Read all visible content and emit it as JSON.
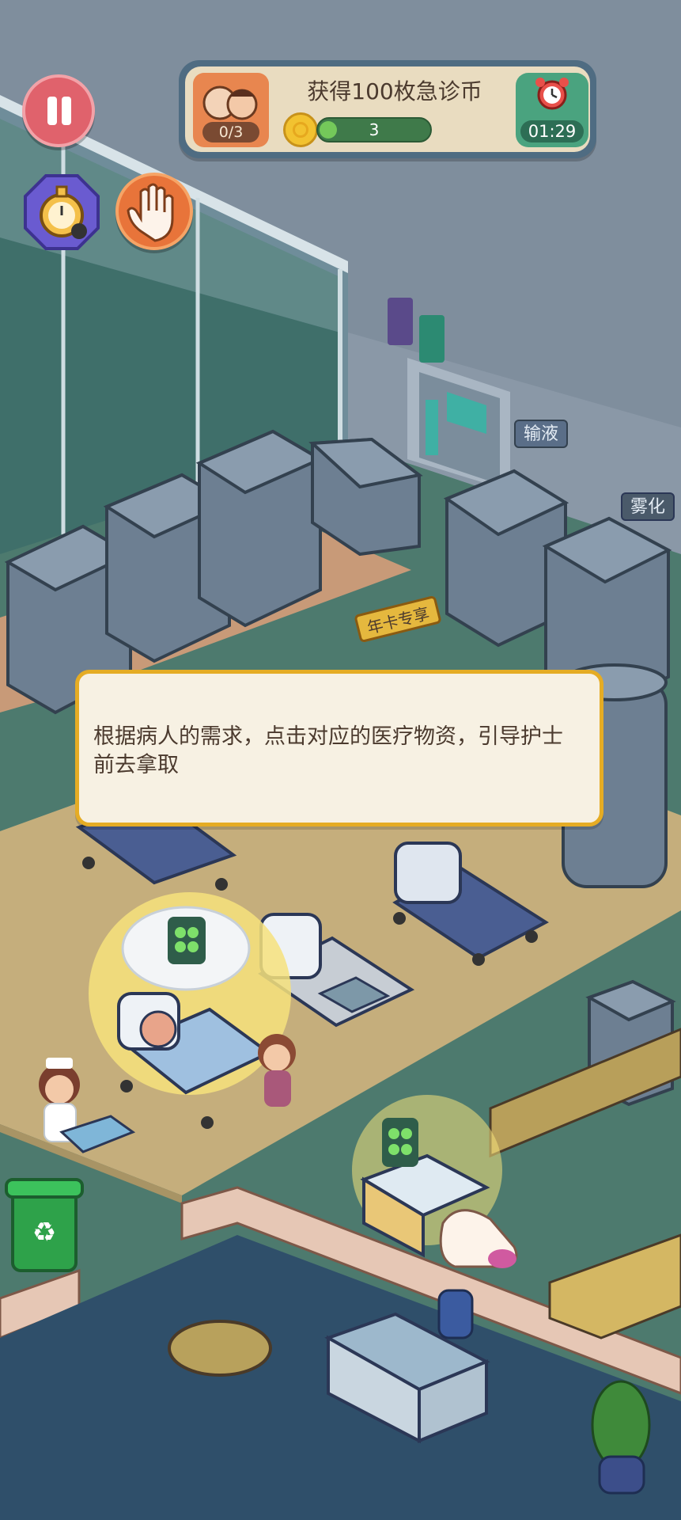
{
  "hud": {
    "task": {
      "title": "获得100枚急诊币",
      "patients_progress": "0/3",
      "coin_value": "3",
      "coin_progress_fraction": 0.08,
      "timer": "01:29"
    },
    "buttons": [
      "pause-icon",
      "stopwatch-icon",
      "hand-icon"
    ]
  },
  "signs": {
    "infusion": "输液",
    "nebulization": "雾化",
    "annual_card": "年卡专享"
  },
  "tutorial": {
    "text": "根据病人的需求，点击对应的医疗物资，引导护士前去拿取"
  },
  "colors": {
    "floor": "#c9b483",
    "wall": "#4b7169",
    "tip_border": "#e5ac24",
    "highlight": "#f6e27c"
  }
}
